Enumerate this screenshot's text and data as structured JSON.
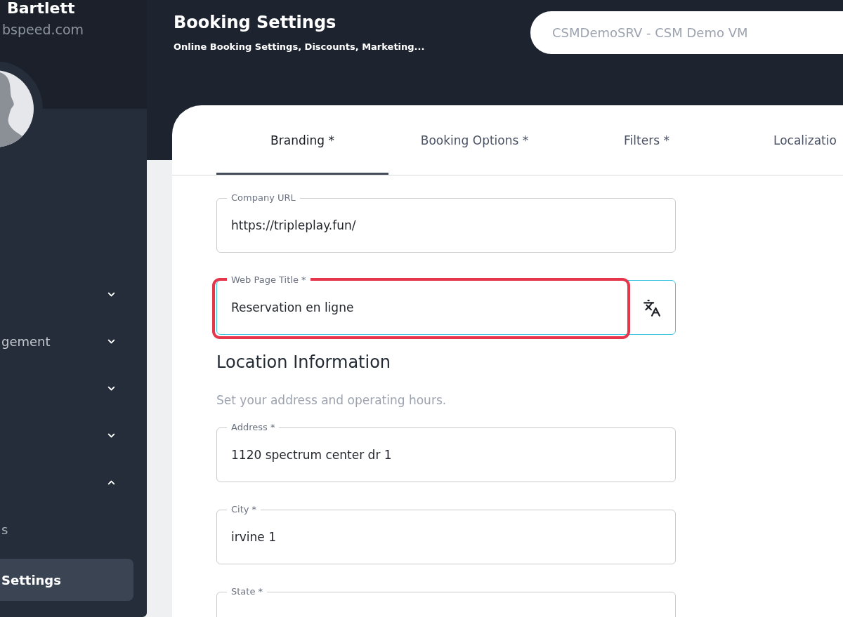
{
  "sidebar": {
    "user_name": "Bartlett",
    "user_email": "bspeed.com",
    "nav_items": [
      {
        "expanded": false
      },
      {
        "label": "gement",
        "expanded": false
      },
      {
        "expanded": false
      },
      {
        "expanded": false
      },
      {
        "expanded": true,
        "children": [
          {
            "label": "s",
            "selected": false
          },
          {
            "label": "Settings",
            "selected": true
          }
        ]
      }
    ]
  },
  "header": {
    "title": "Booking Settings",
    "subtitle": "Online Booking Settings, Discounts, Marketing...",
    "location_select": {
      "value": "CSMDemoSRV - CSM Demo VM"
    }
  },
  "tabs": [
    {
      "label": "Branding *",
      "selected": true
    },
    {
      "label": "Booking Options *",
      "selected": false
    },
    {
      "label": "Filters *",
      "selected": false
    },
    {
      "label": "Localizatio",
      "selected": false
    }
  ],
  "branding_fields": [
    {
      "label": "Company URL",
      "value": "https://tripleplay.fun/",
      "focused": false,
      "highlighted": false
    },
    {
      "label": "Web Page Title *",
      "value": "Reservation en ligne",
      "focused": true,
      "highlighted": true,
      "translate_button": true
    }
  ],
  "location": {
    "heading": "Location Information",
    "description": "Set your address and operating hours.",
    "fields": [
      {
        "label": "Address *",
        "value": "1120 spectrum center dr 1",
        "focused": false,
        "highlighted": false
      },
      {
        "label": "City *",
        "value": "irvine 1",
        "focused": false,
        "highlighted": false
      },
      {
        "label": "State *",
        "focused": false,
        "highlighted": false
      }
    ]
  }
}
